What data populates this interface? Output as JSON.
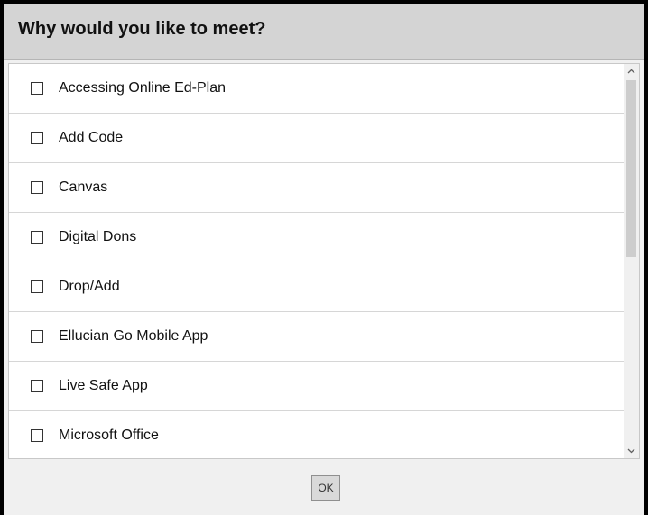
{
  "dialog": {
    "title": "Why would you like to meet?",
    "ok_label": "OK"
  },
  "reasons": [
    {
      "label": "Accessing Online Ed-Plan",
      "checked": false
    },
    {
      "label": "Add Code",
      "checked": false
    },
    {
      "label": "Canvas",
      "checked": false
    },
    {
      "label": "Digital Dons",
      "checked": false
    },
    {
      "label": "Drop/Add",
      "checked": false
    },
    {
      "label": "Ellucian Go Mobile App",
      "checked": false
    },
    {
      "label": "Live Safe App",
      "checked": false
    },
    {
      "label": "Microsoft Office",
      "checked": false
    }
  ],
  "icons": {
    "scroll_up": "chevron-up-icon",
    "scroll_down": "chevron-down-icon",
    "checkbox": "empty-checkbox"
  }
}
